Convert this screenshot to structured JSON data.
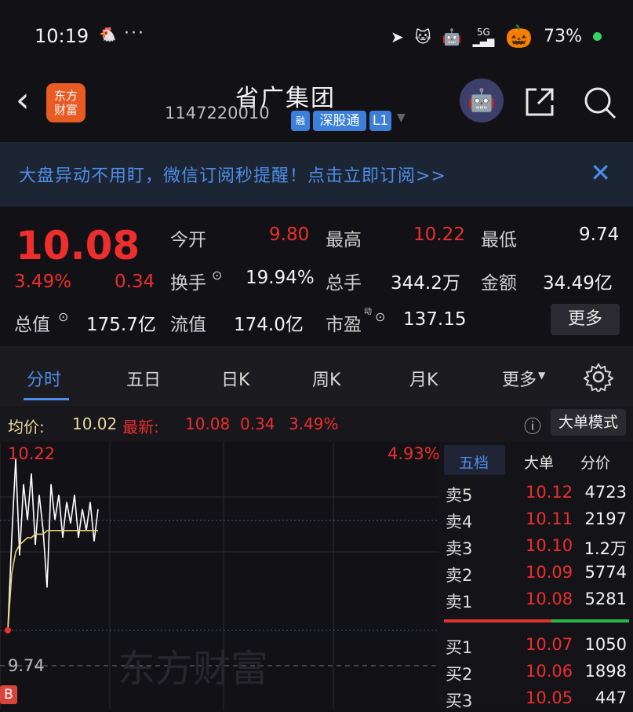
{
  "status_bar": {
    "time": "10:19",
    "battery": "73%",
    "signal": "5G"
  },
  "header": {
    "logo_line1": "东方",
    "logo_line2": "财富",
    "stock_name": "省广集团",
    "stock_code": "1147220010",
    "tags": [
      "融",
      "深股通",
      "L1"
    ]
  },
  "banner": {
    "text": "大盘异动不用盯，微信订阅秒提醒！点击立即订阅>>"
  },
  "quote": {
    "price": "10.08",
    "change_pct": "3.49%",
    "change": "0.34",
    "open_label": "今开",
    "open": "9.80",
    "high_label": "最高",
    "high": "10.22",
    "low_label": "最低",
    "low": "9.74",
    "turnover_label": "换手",
    "turnover": "19.94%",
    "volume_label": "总手",
    "volume": "344.2万",
    "amount_label": "金额",
    "amount": "34.49亿",
    "mktcap_label": "总值",
    "mktcap": "175.7亿",
    "float_label": "流值",
    "float": "174.0亿",
    "pe_label": "市盈",
    "pe_sup": "动",
    "pe": "137.15",
    "more": "更多"
  },
  "tabs": [
    "分时",
    "五日",
    "日K",
    "周K",
    "月K",
    "更多"
  ],
  "avg_row": {
    "avg_label": "均价:",
    "avg": "10.02",
    "latest_label": "最新:",
    "latest": "10.08",
    "change": "0.34",
    "change_pct": "3.49%",
    "mode_button": "大单模式"
  },
  "chart": {
    "high_label": "10.22",
    "pct_label": "4.93%",
    "low_label": "9.74",
    "b_marker": "B",
    "watermark": "东方财富"
  },
  "order_book": {
    "tabs": [
      "五档",
      "大单",
      "分价"
    ],
    "sell": [
      {
        "label": "卖5",
        "price": "10.12",
        "qty": "4723"
      },
      {
        "label": "卖4",
        "price": "10.11",
        "qty": "2197"
      },
      {
        "label": "卖3",
        "price": "10.10",
        "qty": "1.2万"
      },
      {
        "label": "卖2",
        "price": "10.09",
        "qty": "5774"
      },
      {
        "label": "卖1",
        "price": "10.08",
        "qty": "5281"
      }
    ],
    "buy": [
      {
        "label": "买1",
        "price": "10.07",
        "qty": "1050"
      },
      {
        "label": "买2",
        "price": "10.06",
        "qty": "1898"
      },
      {
        "label": "买3",
        "price": "10.05",
        "qty": "447"
      }
    ]
  },
  "chart_data": {
    "type": "line",
    "ylim": [
      9.74,
      10.22
    ],
    "series": [
      {
        "values": [
          9.74,
          10.0,
          10.22,
          9.95,
          10.15,
          10.05,
          10.18,
          9.98,
          10.12,
          10.02,
          9.86,
          10.15,
          10.05,
          10.12,
          10.0,
          10.1,
          10.04,
          10.12,
          10.0,
          10.08,
          10.02,
          10.1,
          9.99,
          10.08
        ]
      },
      {
        "values": [
          9.74,
          9.9,
          9.96,
          9.98,
          9.99,
          10.0,
          10.0,
          10.01,
          10.01,
          10.01,
          10.02,
          10.02,
          10.02,
          10.02,
          10.02,
          10.02,
          10.02,
          10.02,
          10.02,
          10.02,
          10.02,
          10.02,
          10.02,
          10.02
        ]
      }
    ]
  }
}
